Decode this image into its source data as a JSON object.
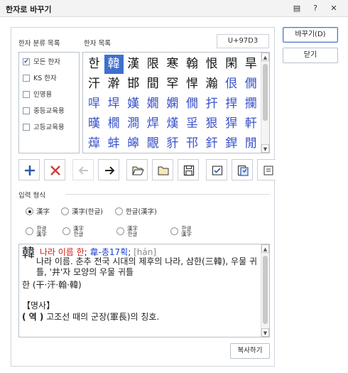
{
  "window": {
    "title": "한자로 바꾸기",
    "btn_menu": "▤",
    "btn_help": "?",
    "btn_close": "✕"
  },
  "actions": {
    "replace_label": "바꾸기(D)",
    "close_label": "닫기"
  },
  "categories": {
    "header": "한자 분류 목록",
    "items": [
      {
        "label": "모든 한자",
        "checked": true
      },
      {
        "label": "KS 한자",
        "checked": false
      },
      {
        "label": "인명용",
        "checked": false
      },
      {
        "label": "중등교육용",
        "checked": false
      },
      {
        "label": "고등교육용",
        "checked": false
      }
    ]
  },
  "hanja_list": {
    "header": "한자 목록",
    "codepoint": "U+97D3",
    "rows": [
      [
        "한",
        "韓",
        "漢",
        "限",
        "寒",
        "翰",
        "恨",
        "閑",
        "旱"
      ],
      [
        "汗",
        "澣",
        "邯",
        "間",
        "罕",
        "悍",
        "瀚",
        "佷",
        "僩"
      ],
      [
        "哻",
        "垾",
        "嫨",
        "嫺",
        "嫻",
        "僩",
        "扞",
        "捍",
        "攔"
      ],
      [
        "暵",
        "橌",
        "澗",
        "焊",
        "熯",
        "㸒",
        "狠",
        "猂",
        "軒"
      ],
      [
        "蔊",
        "蚌",
        "皞",
        "覵",
        "豻",
        "邗",
        "釬",
        "銲",
        "閒"
      ]
    ],
    "blue_flags": [
      [
        false,
        false,
        false,
        false,
        false,
        false,
        false,
        false,
        false
      ],
      [
        false,
        false,
        false,
        false,
        false,
        false,
        false,
        true,
        true
      ],
      [
        true,
        true,
        true,
        true,
        true,
        true,
        true,
        true,
        true
      ],
      [
        true,
        true,
        true,
        true,
        true,
        true,
        true,
        true,
        true
      ],
      [
        true,
        true,
        true,
        true,
        true,
        true,
        true,
        true,
        true
      ]
    ],
    "selected": {
      "row": 0,
      "col": 1
    }
  },
  "toolbar": {
    "buttons": [
      "add-icon",
      "delete-icon",
      "arrow-left-icon",
      "arrow-right-icon",
      "open-folder-icon",
      "folder-icon",
      "save-icon",
      "checklist-icon",
      "dict-view-icon",
      "convert-icon"
    ]
  },
  "input_format": {
    "header": "입력 형식",
    "options_row1": [
      "漢字",
      "漢字(한글)",
      "한글(漢字)"
    ],
    "options_row2": [
      {
        "top": "한글",
        "bottom": "漢字"
      },
      {
        "top": "漢字",
        "bottom": "한글"
      },
      {
        "top": "漢字",
        "bottom": "한글"
      },
      {
        "top": "한글",
        "bottom": "漢字"
      }
    ],
    "selected_index": 0
  },
  "description": {
    "hanja": "韓",
    "reading": "나라 이름 한",
    "radical": "韋-총17획",
    "pron": "[hán]",
    "definition": "나라 이름. 춘추 전국 시대의 제후의 나라, 삼한(三韓), 우물 귀틀, '井'자 모양의 우물 귀틀",
    "variants": "한 (干·汗·翰·韓)",
    "noun_label": "【명사】",
    "example_tag": "( 역 )",
    "example_text": "고조선 때의 군장(軍長)의 칭호."
  },
  "copy_button": {
    "label": "복사하기"
  },
  "colors": {
    "selected_bg": "#3f6fd0",
    "blue_hanja": "#3a52c8",
    "reading_red": "#d11a1a",
    "radical_blue": "#1a3fd1"
  }
}
